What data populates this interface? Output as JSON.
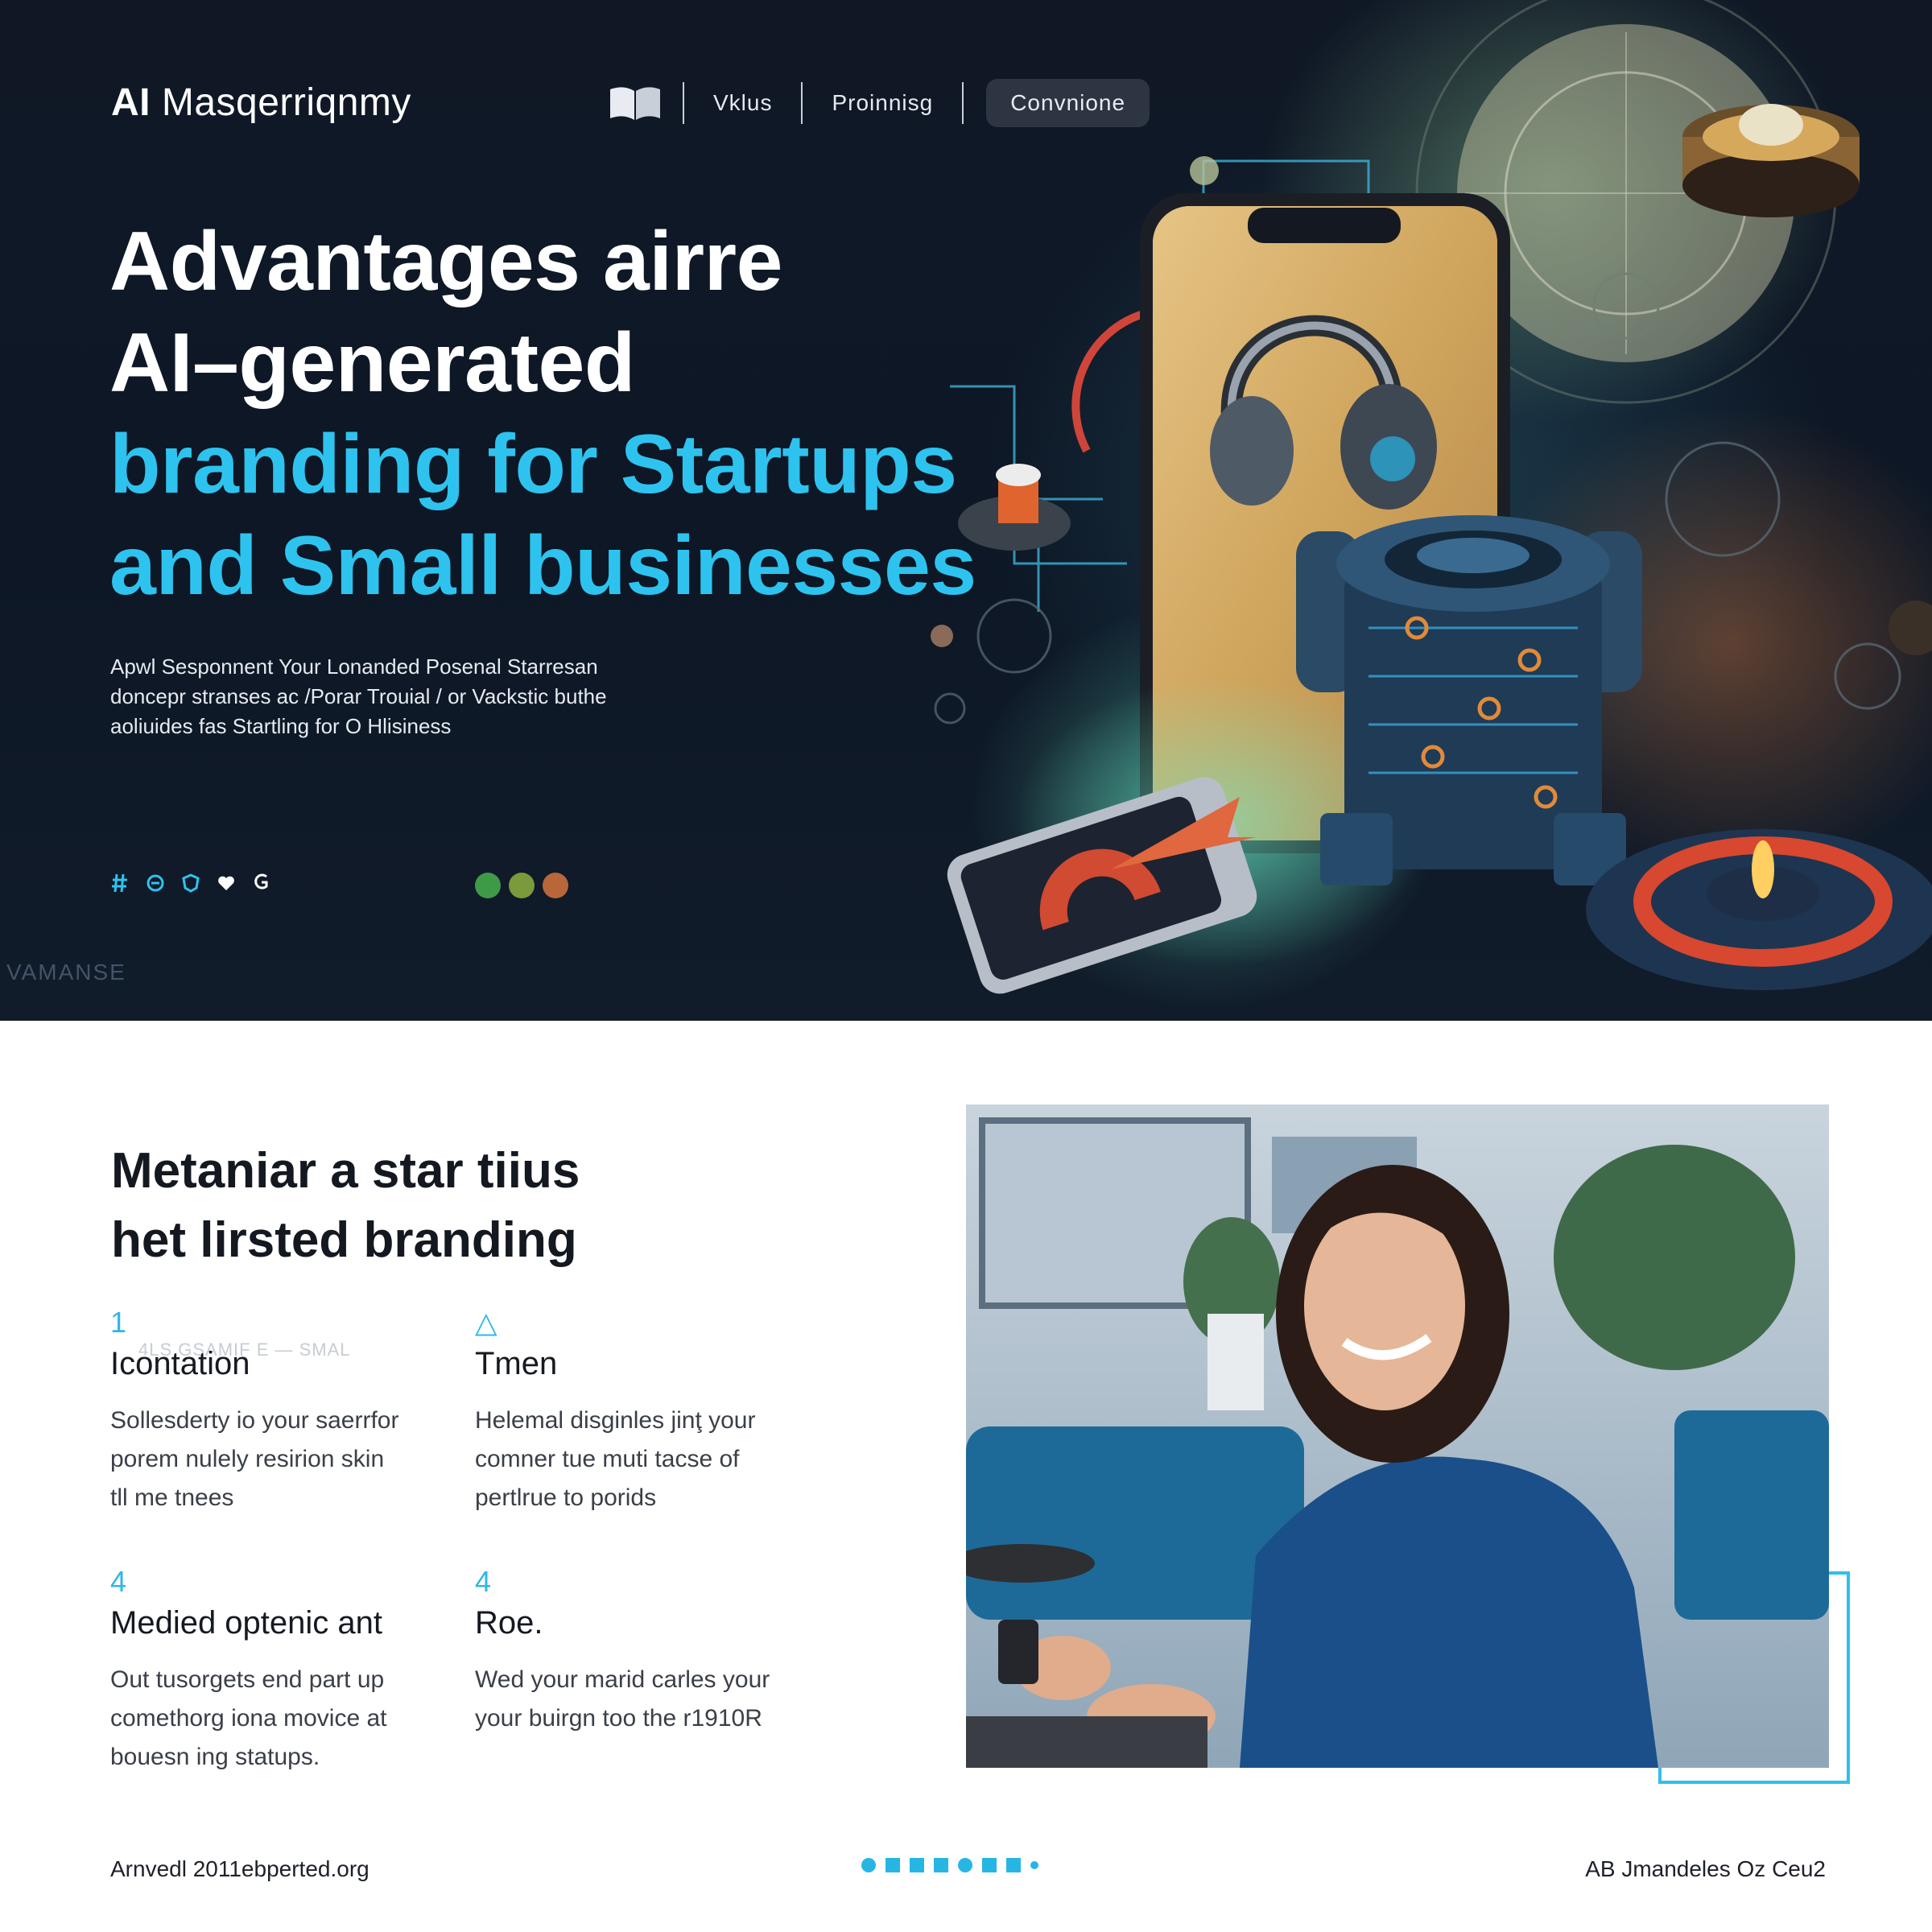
{
  "header": {
    "brand_prefix": "AI",
    "brand_rest": " Masqerriqnmy",
    "nav": {
      "link1": "Vklus",
      "link2": "Proinnisg",
      "cta": "Convnione"
    }
  },
  "hero": {
    "title_line1": "Advantages airre",
    "title_line2": "AI–generated",
    "title_line3": "branding for Startups",
    "title_line4": "and Small businesses",
    "subtitle_line1": "Apwl Sesponnent Your Lonanded Posenal Starresan",
    "subtitle_line2": "doncepr stranses ac /Porar Trouial / or Vackstic buthe",
    "subtitle_line3": "aoliuides fas Startling for O Hlisiness",
    "watermark": "VAMANSE",
    "dot_colors": [
      "#3f9a48",
      "#7a9a3c",
      "#b8673a"
    ]
  },
  "section": {
    "title_line1": "Metaniar a star tiius",
    "title_line2": "het lirsted branding",
    "ghost_text": "4LS GSAMIF E — SMAL",
    "features": [
      {
        "num": "1",
        "title": "Icontation",
        "text_line1": "Sollesderty io your saerrfor",
        "text_line2": "porem nulely resirion skin",
        "text_line3": "tll me tnees"
      },
      {
        "num": "△",
        "title": "Tmen",
        "text_line1": "Helemal disginles jinţ your",
        "text_line2": "comner tue muti tacse of",
        "text_line3": "pertlrue to porids"
      },
      {
        "num": "4",
        "title": "Medied optenic ant",
        "text_line1": "Out tusorgets end part up",
        "text_line2": "comethorg iona movice at",
        "text_line3": "bouesn ing statups."
      },
      {
        "num": "4",
        "title": "Roe.",
        "text_line1": "Wed your marid carles your",
        "text_line2": "your buirgn too the r1910R",
        "text_line3": ""
      }
    ]
  },
  "footer": {
    "left": "Arnvedl 2011ebperted.org",
    "right": "AB Jmandeles Oz Ceu2"
  },
  "colors": {
    "accent": "#2ec3ef",
    "hero_bg": "#0f1826",
    "text_dark": "#141820"
  }
}
